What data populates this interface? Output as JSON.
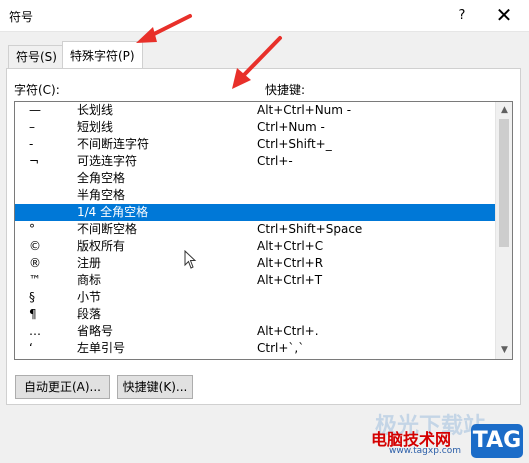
{
  "window": {
    "title": "符号",
    "help": "?",
    "close": "✕"
  },
  "tabs": [
    {
      "label": "符号(S)"
    },
    {
      "label": "特殊字符(P)"
    }
  ],
  "columns": {
    "symbol": "字符(C):",
    "shortcut": "快捷键:"
  },
  "rows": [
    {
      "symbol": "—",
      "name": "长划线",
      "shortcut": "Alt+Ctrl+Num -"
    },
    {
      "symbol": "–",
      "name": "短划线",
      "shortcut": "Ctrl+Num -"
    },
    {
      "symbol": "-",
      "name": "不间断连字符",
      "shortcut": "Ctrl+Shift+_"
    },
    {
      "symbol": "¬",
      "name": "可选连字符",
      "shortcut": "Ctrl+-"
    },
    {
      "symbol": "",
      "name": "全角空格",
      "shortcut": ""
    },
    {
      "symbol": "",
      "name": "半角空格",
      "shortcut": ""
    },
    {
      "symbol": "",
      "name": "1/4 全角空格",
      "shortcut": "",
      "selected": true
    },
    {
      "symbol": "°",
      "name": "不间断空格",
      "shortcut": "Ctrl+Shift+Space"
    },
    {
      "symbol": "©",
      "name": "版权所有",
      "shortcut": "Alt+Ctrl+C"
    },
    {
      "symbol": "®",
      "name": "注册",
      "shortcut": "Alt+Ctrl+R"
    },
    {
      "symbol": "™",
      "name": "商标",
      "shortcut": "Alt+Ctrl+T"
    },
    {
      "symbol": "§",
      "name": "小节",
      "shortcut": ""
    },
    {
      "symbol": "¶",
      "name": "段落",
      "shortcut": ""
    },
    {
      "symbol": "…",
      "name": "省略号",
      "shortcut": "Alt+Ctrl+."
    },
    {
      "symbol": "‘",
      "name": "左单引号",
      "shortcut": "Ctrl+`,`"
    }
  ],
  "scrollbar": {
    "up": "▲",
    "down": "▼"
  },
  "buttons": {
    "autocorrect": "自动更正(A)...",
    "shortcut_key": "快捷键(K)..."
  },
  "watermark": {
    "shadow_text": "极光下载站",
    "site_name": "电脑技术网",
    "url": "www.tagxp.com",
    "tag": "TAG"
  },
  "colors": {
    "selection": "#0078d7",
    "arrow": "#e8302a"
  }
}
